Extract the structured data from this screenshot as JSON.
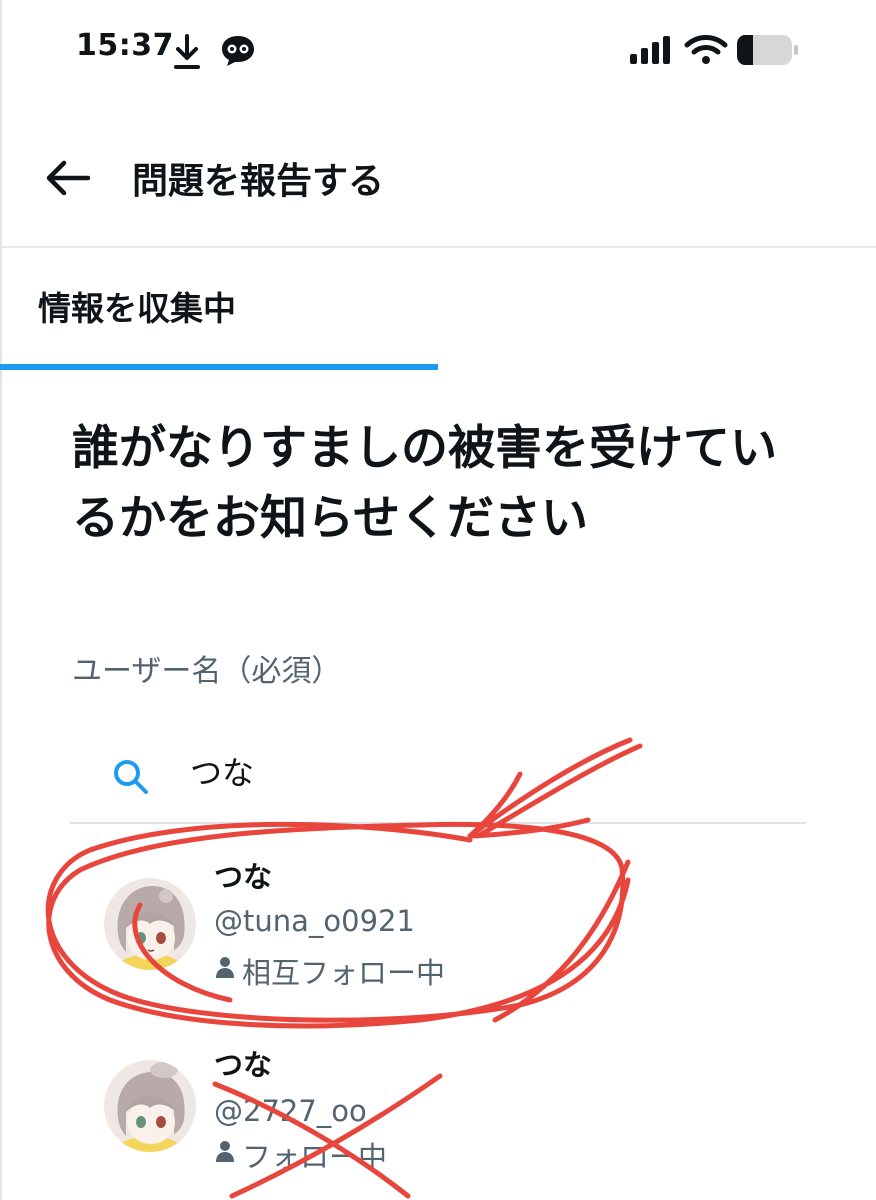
{
  "status_bar": {
    "time": "15:37"
  },
  "header": {
    "title": "問題を報告する"
  },
  "step": {
    "label": "情報を収集中",
    "progress": 0.5
  },
  "question": "誰がなりすましの被害を受けているかをお知らせください",
  "field_label": "ユーザー名（必須）",
  "search": {
    "value": "つな",
    "placeholder": ""
  },
  "users": [
    {
      "name": "つな",
      "handle": "@tuna_o0921",
      "follow_status": "相互フォロー中"
    },
    {
      "name": "つな",
      "handle": "@2727_oo",
      "follow_status": "フォロー中"
    }
  ],
  "colors": {
    "accent": "#1d9bf0",
    "annotation": "#e8453c",
    "secondary_text": "#536471"
  },
  "icons": [
    "download-icon",
    "chat-icon",
    "signal-icon",
    "wifi-icon",
    "battery-icon",
    "back-arrow-icon",
    "search-icon",
    "person-icon"
  ]
}
